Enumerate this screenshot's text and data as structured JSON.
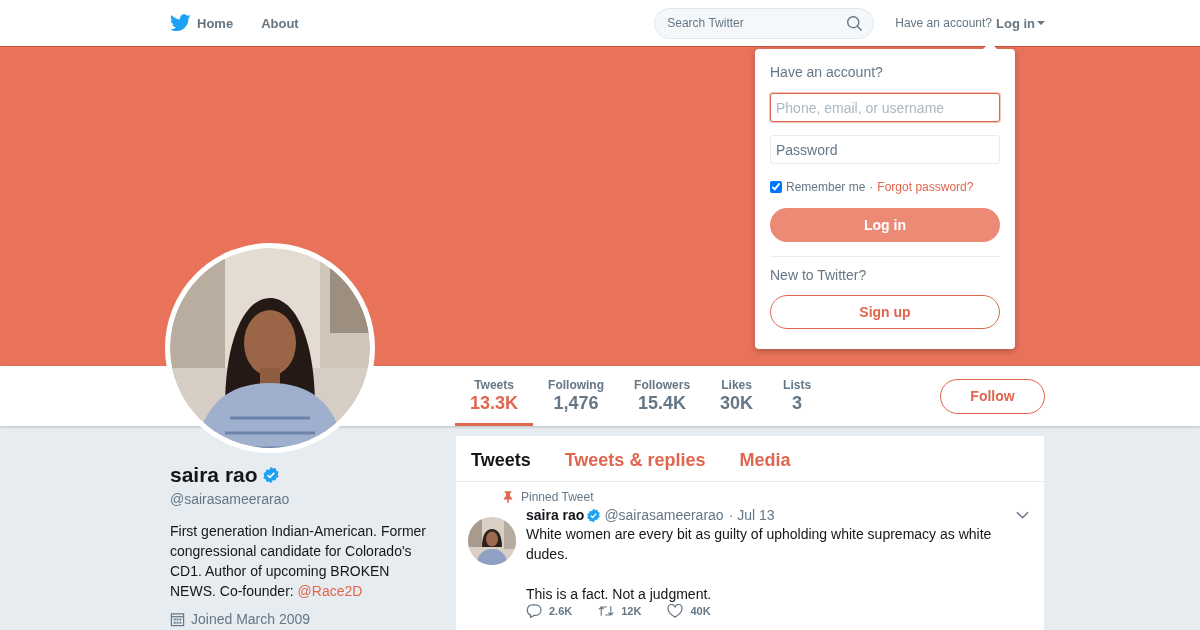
{
  "nav": {
    "items": [
      {
        "label": "Home",
        "kind": "home"
      },
      {
        "label": "About",
        "kind": "plain"
      }
    ],
    "search": {
      "placeholder": "Search Twitter"
    },
    "account_prompt": "Have an account?",
    "login": "Log in"
  },
  "login_dropdown": {
    "heading": "Have an account?",
    "username": {
      "placeholder": "Phone, email, or username",
      "focused": true
    },
    "password": {
      "placeholder": "Password",
      "focused": false
    },
    "remember": {
      "label": "Remember me",
      "checked": true
    },
    "separator": "·",
    "forgot": "Forgot password?",
    "login_button": "Log in",
    "new_prompt": "New to Twitter?",
    "signup_button": "Sign up"
  },
  "stats": [
    {
      "label": "Tweets",
      "value": "13.3K",
      "selected": true
    },
    {
      "label": "Following",
      "value": "1,476",
      "selected": false
    },
    {
      "label": "Followers",
      "value": "15.4K",
      "selected": false
    },
    {
      "label": "Likes",
      "value": "30K",
      "selected": false
    },
    {
      "label": "Lists",
      "value": "3",
      "selected": false
    }
  ],
  "follow_button": "Follow",
  "profile": {
    "name": "saira rao",
    "verified": true,
    "handle": "@sairasameerarao",
    "bio": "First generation Indian-American. Former congressional candidate for Colorado's CD1. Author of upcoming BROKEN NEWS. Co-founder: ",
    "bio_link": "@Race2D",
    "joined": "Joined March 2009"
  },
  "tabs": [
    {
      "label": "Tweets",
      "selected": true
    },
    {
      "label": "Tweets & replies",
      "selected": false
    },
    {
      "label": "Media",
      "selected": false
    }
  ],
  "tweet": {
    "pinned_label": "Pinned Tweet",
    "name": "saira rao",
    "verified": true,
    "handle": "@sairasameerarao",
    "date": "· Jul 13",
    "text": "White women are every bit as guilty of upholding white supremacy as white dudes.\n\nThis is a fact. Not a judgment.",
    "actions": [
      {
        "kind": "reply",
        "count": "2.6K"
      },
      {
        "kind": "retweet",
        "count": "12K"
      },
      {
        "kind": "like",
        "count": "40K"
      }
    ]
  }
}
